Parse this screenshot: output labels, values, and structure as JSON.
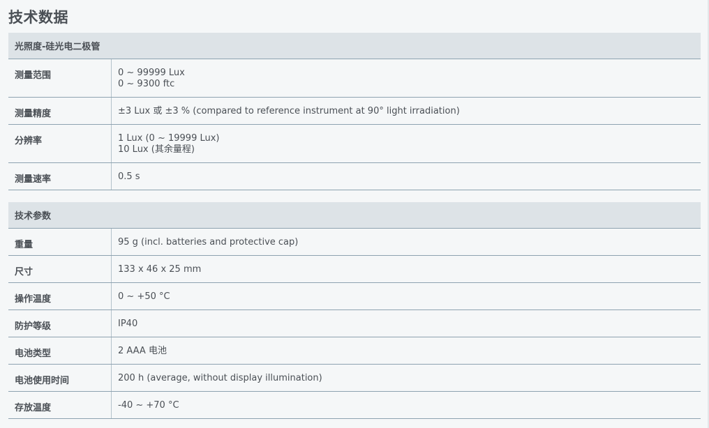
{
  "page_title": "技术数据",
  "sections": [
    {
      "title": "光照度-硅光电二极管",
      "rows": [
        {
          "label": "测量范围",
          "values": [
            "0 ~ 99999 Lux",
            "0 ~ 9300 ftc"
          ]
        },
        {
          "label": "测量精度",
          "values": [
            "±3 Lux 或 ±3 % (compared to reference instrument at 90° light irradiation)"
          ]
        },
        {
          "label": "分辨率",
          "values": [
            "1 Lux (0 ~ 19999 Lux)",
            "10 Lux (其余量程)"
          ]
        },
        {
          "label": "测量速率",
          "values": [
            "0.5 s"
          ]
        }
      ]
    },
    {
      "title": "技术参数",
      "rows": [
        {
          "label": "重量",
          "values": [
            "95 g (incl. batteries and protective cap)"
          ]
        },
        {
          "label": "尺寸",
          "values": [
            "133 x 46 x 25 mm"
          ]
        },
        {
          "label": "操作温度",
          "values": [
            "0 ~ +50 °C"
          ]
        },
        {
          "label": "防护等级",
          "values": [
            "IP40"
          ]
        },
        {
          "label": "电池类型",
          "values": [
            "2 AAA 电池"
          ]
        },
        {
          "label": "电池使用时间",
          "values": [
            "200 h (average, without display illumination)"
          ]
        },
        {
          "label": "存放温度",
          "values": [
            "-40 ~ +70 °C"
          ]
        }
      ]
    }
  ]
}
